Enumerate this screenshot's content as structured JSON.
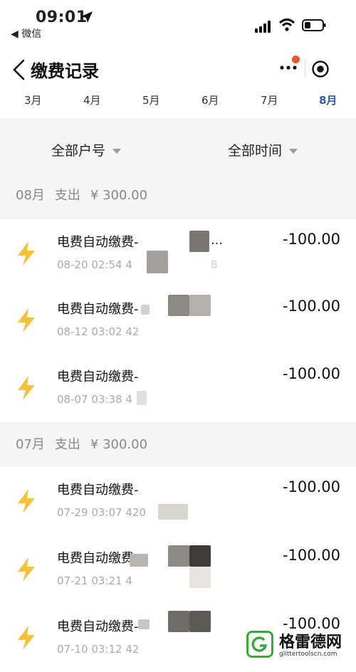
{
  "status_bar": {
    "time": "09:01",
    "back_app": "◀ 微信"
  },
  "navbar": {
    "title": "缴费记录"
  },
  "months": [
    {
      "label": "3月",
      "active": false
    },
    {
      "label": "4月",
      "active": false
    },
    {
      "label": "5月",
      "active": false
    },
    {
      "label": "6月",
      "active": false
    },
    {
      "label": "7月",
      "active": false
    },
    {
      "label": "8月",
      "active": true
    }
  ],
  "filters": {
    "account": "全部户号",
    "time": "全部时间"
  },
  "sections": [
    {
      "month": "08月",
      "type": "支出",
      "total": "¥ 300.00",
      "records": [
        {
          "title": "电费自动缴费-",
          "title_tail": "…",
          "date": "08-20 02:54 4",
          "date_tail": "8",
          "amount": "-100.00"
        },
        {
          "title": "电费自动缴费-",
          "title_tail": "",
          "date": "08-12 03:02 42",
          "date_tail": "",
          "amount": "-100.00"
        },
        {
          "title": "电费自动缴费-",
          "title_tail": "",
          "date": "08-07 03:38 4",
          "date_tail": "",
          "amount": "-100.00"
        }
      ]
    },
    {
      "month": "07月",
      "type": "支出",
      "total": "¥ 300.00",
      "records": [
        {
          "title": "电费自动缴费-",
          "title_tail": "",
          "date": "07-29 03:07 420",
          "date_tail": "",
          "amount": "-100.00"
        },
        {
          "title": "电费自动缴费-",
          "title_tail": "",
          "date": "07-21 03:21 4",
          "date_tail": "",
          "amount": "-100.00"
        },
        {
          "title": "电费自动缴费-",
          "title_tail": "",
          "date": "07-10 03:12 42",
          "date_tail": "",
          "amount": "-100.00"
        }
      ]
    }
  ],
  "watermark": {
    "name": "格雷德网",
    "url": "glittertoolscn.com"
  },
  "colors": {
    "accent": "#2b5fa6",
    "bolt": "#f4c23a",
    "notification": "#e55a2b"
  }
}
